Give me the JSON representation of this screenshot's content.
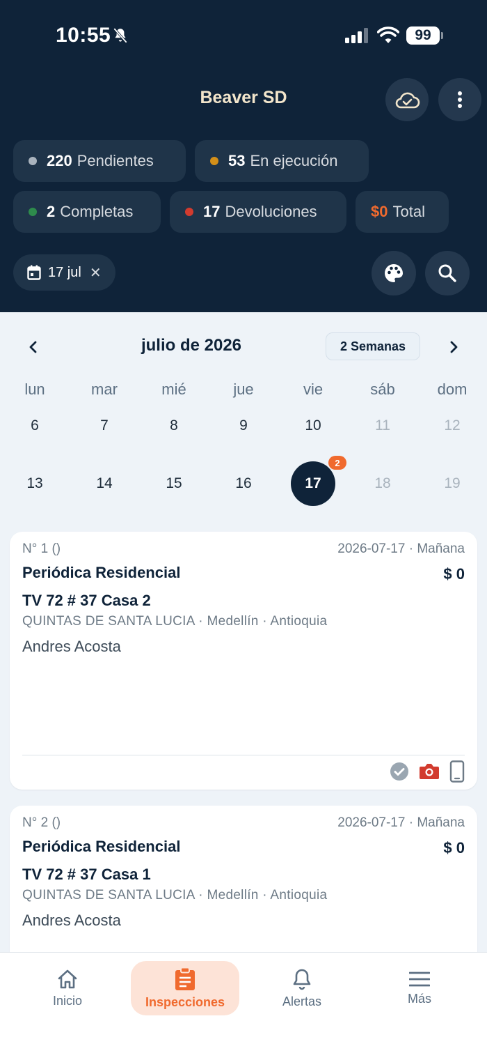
{
  "status_bar": {
    "time": "10:55",
    "battery": "99"
  },
  "header": {
    "title": "Beaver SD",
    "stats": [
      {
        "count": "220",
        "label": "Pendientes",
        "dot_color": "#a9b3bd"
      },
      {
        "count": "53",
        "label": "En ejecución",
        "dot_color": "#d38f19"
      },
      {
        "count": "2",
        "label": "Completas",
        "dot_color": "#2e8b4c"
      },
      {
        "count": "17",
        "label": "Devoluciones",
        "dot_color": "#d23b2e"
      },
      {
        "count": "$0",
        "label": "Total",
        "count_color": "#f06a2e"
      }
    ],
    "date_filter": "17 jul"
  },
  "calendar": {
    "month_title": "julio de 2026",
    "view_mode": "2 Semanas",
    "weekdays": [
      "lun",
      "mar",
      "mié",
      "jue",
      "vie",
      "sáb",
      "dom"
    ],
    "week1": [
      "6",
      "7",
      "8",
      "9",
      "10",
      "11",
      "12"
    ],
    "week2": [
      "13",
      "14",
      "15",
      "16",
      "17",
      "18",
      "19"
    ],
    "selected_day": "17",
    "selected_badge": "2"
  },
  "inspections": [
    {
      "number": "N° 1 ()",
      "date": "2026-07-17 · Mañana",
      "type": "Periódica Residencial",
      "price": "$ 0",
      "address": "TV 72 # 37 Casa 2",
      "location": "QUINTAS DE SANTA LUCIA · Medellín · Antioquia",
      "person": "Andres Acosta"
    },
    {
      "number": "N° 2 ()",
      "date": "2026-07-17 · Mañana",
      "type": "Periódica Residencial",
      "price": "$ 0",
      "address": "TV 72 # 37 Casa 1",
      "location": "QUINTAS DE SANTA LUCIA · Medellín · Antioquia",
      "person": "Andres Acosta"
    }
  ],
  "bottom_nav": [
    {
      "label": "Inicio",
      "icon": "home-icon"
    },
    {
      "label": "Inspecciones",
      "icon": "clipboard-icon",
      "active": true
    },
    {
      "label": "Alertas",
      "icon": "bell-icon"
    },
    {
      "label": "Más",
      "icon": "menu-icon"
    }
  ],
  "colors": {
    "navy": "#0f2339",
    "accent": "#f06a2e",
    "background": "#eef3f8"
  }
}
